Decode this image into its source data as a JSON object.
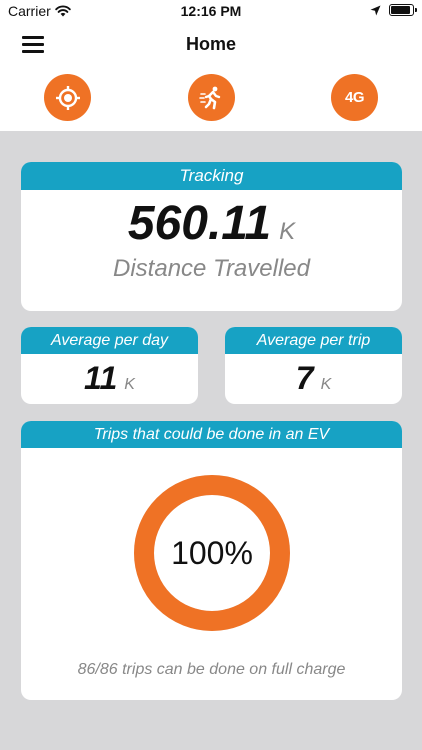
{
  "status_bar": {
    "carrier": "Carrier",
    "time": "12:16 PM",
    "battery_level": 0.9,
    "icons": [
      "wifi-icon",
      "location-arrow-icon",
      "battery-icon"
    ]
  },
  "nav": {
    "title": "Home",
    "menu_icon": "hamburger-menu-icon"
  },
  "quick_actions": [
    {
      "icon": "location-target-icon"
    },
    {
      "icon": "running-person-icon"
    },
    {
      "icon": "network-4g-icon",
      "label": "4G"
    }
  ],
  "tracking": {
    "header": "Tracking",
    "value": "560.11",
    "unit": "K",
    "caption": "Distance Travelled"
  },
  "average_per_day": {
    "header": "Average per day",
    "value": "11",
    "unit": "K"
  },
  "average_per_trip": {
    "header": "Average per trip",
    "value": "7",
    "unit": "K"
  },
  "ev_trips": {
    "header": "Trips that could be done in an EV",
    "percent_label": "100%",
    "fraction": 1.0,
    "caption": "86/86 trips can be done on full charge"
  },
  "colors": {
    "accent_orange": "#ef7225",
    "header_teal": "#17a2c4",
    "background_gray": "#d7d7d9"
  }
}
